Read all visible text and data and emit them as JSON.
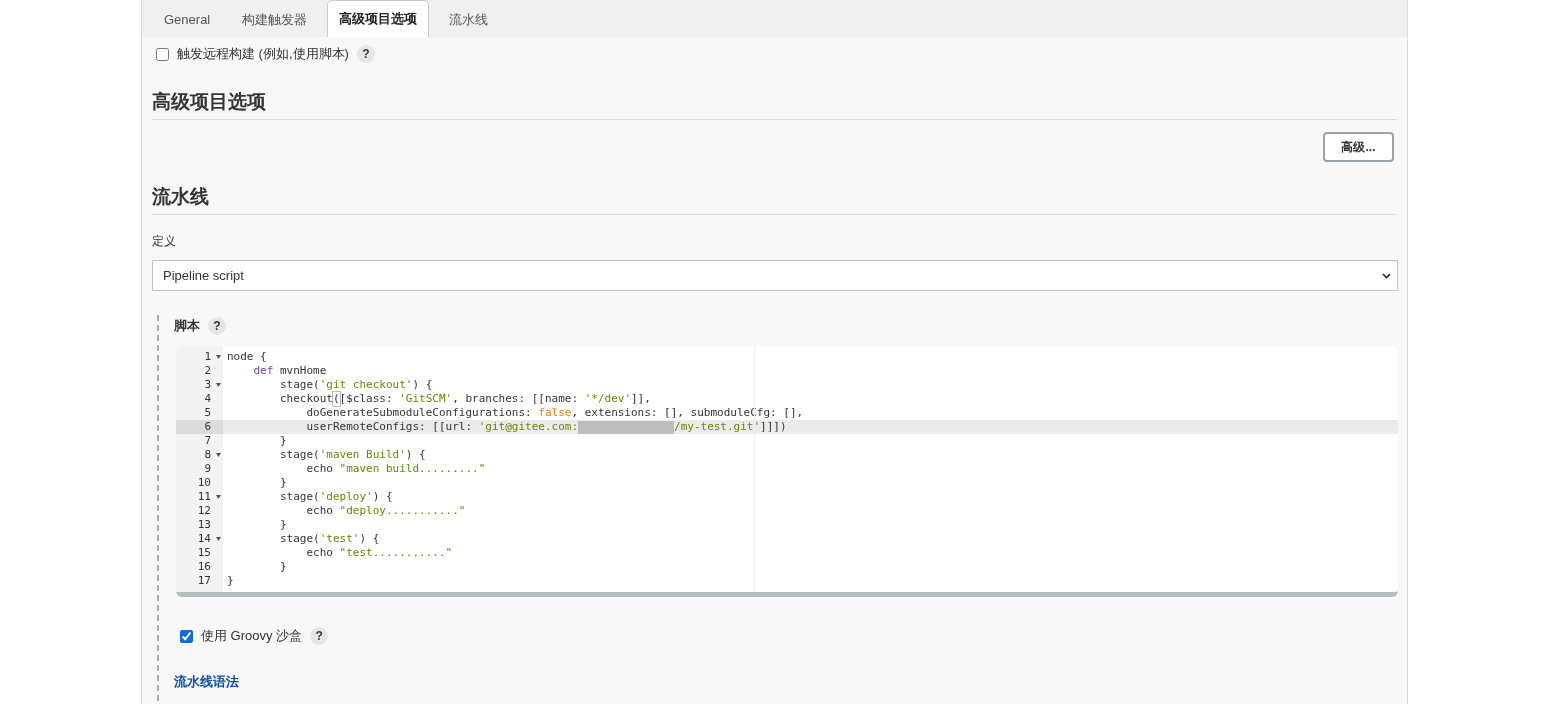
{
  "tabs": [
    {
      "label": "General",
      "selected": false
    },
    {
      "label": "构建触发器",
      "selected": false
    },
    {
      "label": "高级项目选项",
      "selected": true
    },
    {
      "label": "流水线",
      "selected": false
    }
  ],
  "trigger_options": [
    {
      "label": "触发远程构建 (例如,使用脚本)",
      "checked": false,
      "help": "?"
    }
  ],
  "advanced_section": {
    "title": "高级项目选项",
    "button": "高级..."
  },
  "pipeline_section": {
    "title": "流水线",
    "definition_label": "定义",
    "definition_value": "Pipeline script",
    "script": {
      "label": "脚本",
      "help": "?",
      "lines": [
        {
          "number": "1",
          "foldable": true,
          "active": false,
          "tokens": [
            {
              "kind": "plain",
              "text": "node {"
            }
          ]
        },
        {
          "number": "2",
          "foldable": false,
          "active": false,
          "tokens": [
            {
              "kind": "keyword",
              "text": "    def"
            },
            {
              "kind": "plain",
              "text": " mvnHome"
            }
          ]
        },
        {
          "number": "3",
          "foldable": true,
          "active": false,
          "tokens": [
            {
              "kind": "plain",
              "text": "        stage("
            },
            {
              "kind": "string",
              "text": "'git checkout'"
            },
            {
              "kind": "plain",
              "text": ") {"
            }
          ]
        },
        {
          "number": "4",
          "foldable": false,
          "active": false,
          "tokens": [
            {
              "kind": "plain",
              "text": "        checkout"
            },
            {
              "kind": "matched",
              "text": "("
            },
            {
              "kind": "plain",
              "text": "[$class: "
            },
            {
              "kind": "string",
              "text": "'GitSCM'"
            },
            {
              "kind": "plain",
              "text": ", branches: [[name: "
            },
            {
              "kind": "string",
              "text": "'*/dev'"
            },
            {
              "kind": "plain",
              "text": "]],"
            }
          ]
        },
        {
          "number": "5",
          "foldable": false,
          "active": false,
          "tokens": [
            {
              "kind": "plain",
              "text": "            doGenerateSubmoduleConfigurations: "
            },
            {
              "kind": "literal",
              "text": "false"
            },
            {
              "kind": "plain",
              "text": ", extensions: [], submoduleCfg: [],"
            }
          ]
        },
        {
          "number": "6",
          "foldable": false,
          "active": true,
          "tokens": [
            {
              "kind": "plain",
              "text": "            userRemoteConfigs: [[url: "
            },
            {
              "kind": "string",
              "text": "'git@gitee.com:"
            },
            {
              "kind": "redacted"
            },
            {
              "kind": "string",
              "text": "/my-test.git'"
            },
            {
              "kind": "plain",
              "text": "]]])"
            }
          ]
        },
        {
          "number": "7",
          "foldable": false,
          "active": false,
          "tokens": [
            {
              "kind": "plain",
              "text": "        }"
            }
          ]
        },
        {
          "number": "8",
          "foldable": true,
          "active": false,
          "tokens": [
            {
              "kind": "plain",
              "text": "        stage("
            },
            {
              "kind": "string",
              "text": "'maven Build'"
            },
            {
              "kind": "plain",
              "text": ") {"
            }
          ]
        },
        {
          "number": "9",
          "foldable": false,
          "active": false,
          "tokens": [
            {
              "kind": "plain",
              "text": "            echo "
            },
            {
              "kind": "string",
              "text": "\"maven build.........\""
            }
          ]
        },
        {
          "number": "10",
          "foldable": false,
          "active": false,
          "tokens": [
            {
              "kind": "plain",
              "text": "        }"
            }
          ]
        },
        {
          "number": "11",
          "foldable": true,
          "active": false,
          "tokens": [
            {
              "kind": "plain",
              "text": "        stage("
            },
            {
              "kind": "string",
              "text": "'deploy'"
            },
            {
              "kind": "plain",
              "text": ") {"
            }
          ]
        },
        {
          "number": "12",
          "foldable": false,
          "active": false,
          "tokens": [
            {
              "kind": "plain",
              "text": "            echo "
            },
            {
              "kind": "string",
              "text": "\"deploy...........\""
            }
          ]
        },
        {
          "number": "13",
          "foldable": false,
          "active": false,
          "tokens": [
            {
              "kind": "plain",
              "text": "        }"
            }
          ]
        },
        {
          "number": "14",
          "foldable": true,
          "active": false,
          "tokens": [
            {
              "kind": "plain",
              "text": "        stage("
            },
            {
              "kind": "string",
              "text": "'test'"
            },
            {
              "kind": "plain",
              "text": ") {"
            }
          ]
        },
        {
          "number": "15",
          "foldable": false,
          "active": false,
          "tokens": [
            {
              "kind": "plain",
              "text": "            echo "
            },
            {
              "kind": "string",
              "text": "\"test...........\""
            }
          ]
        },
        {
          "number": "16",
          "foldable": false,
          "active": false,
          "tokens": [
            {
              "kind": "plain",
              "text": "        }"
            }
          ]
        },
        {
          "number": "17",
          "foldable": false,
          "active": false,
          "tokens": [
            {
              "kind": "plain",
              "text": "}"
            }
          ]
        }
      ]
    },
    "sandbox": {
      "label": "使用 Groovy 沙盒",
      "checked": true,
      "help": "?"
    },
    "syntax_link": "流水线语法"
  }
}
